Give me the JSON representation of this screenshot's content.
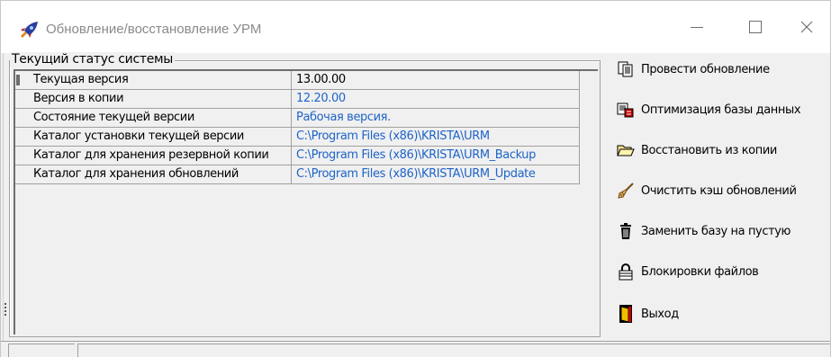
{
  "window": {
    "title": "Обновление/восстановление УРМ",
    "icon": "rocket-icon"
  },
  "status_group": {
    "caption": "Текущий статус системы",
    "rows": [
      {
        "label": "Текущая версия",
        "value": "13.00.00",
        "value_color": "#000000"
      },
      {
        "label": "Версия в копии",
        "value": "12.20.00",
        "value_color": "#1e64c8"
      },
      {
        "label": "Состояние текущей версии",
        "value": "Рабочая версия.",
        "value_color": "#1e64c8"
      },
      {
        "label": "Каталог установки текущей версии",
        "value": "C:\\Program Files (x86)\\KRISTA\\URM",
        "value_color": "#1e64c8"
      },
      {
        "label": "Каталог для хранения резервной копии",
        "value": "C:\\Program Files (x86)\\KRISTA\\URM_Backup",
        "value_color": "#1e64c8"
      },
      {
        "label": "Каталог для хранения обновлений",
        "value": "C:\\Program Files (x86)\\KRISTA\\URM_Update",
        "value_color": "#1e64c8"
      }
    ]
  },
  "actions": [
    {
      "label": "Провести обновление",
      "icon": "copy-pages-icon"
    },
    {
      "label": "Оптимизация базы данных",
      "icon": "database-optimize-icon"
    },
    {
      "label": "Восстановить из копии",
      "icon": "open-folder-icon"
    },
    {
      "label": "Очистить кэш обновлений",
      "icon": "broom-icon"
    },
    {
      "label": "Заменить базу на пустую",
      "icon": "trash-bin-icon"
    },
    {
      "label": "Блокировки файлов",
      "icon": "padlock-icon"
    },
    {
      "label": "Выход",
      "icon": "exit-door-icon"
    }
  ],
  "colors": {
    "link_blue": "#1e64c8",
    "window_bg": "#f0f0f0"
  }
}
